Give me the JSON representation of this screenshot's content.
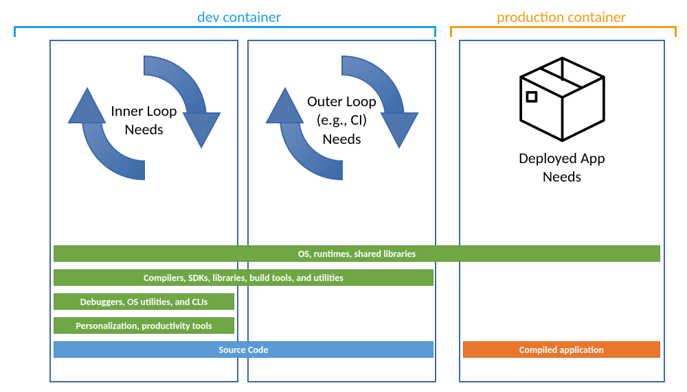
{
  "headers": {
    "dev": "dev container",
    "prod": "production container"
  },
  "columns": {
    "inner": {
      "label": "Inner Loop\nNeeds"
    },
    "outer": {
      "label": "Outer Loop\n(e.g., CI)\nNeeds"
    },
    "prod": {
      "label": "Deployed App\nNeeds"
    }
  },
  "layers": {
    "os": "OS, runtimes, shared libraries",
    "compilers": "Compilers, SDKs, libraries, build tools, and utilities",
    "debug": "Debuggers, OS utilities, and CLIs",
    "person": "Personalization, productivity tools",
    "source": "Source Code",
    "compiled": "Compiled application"
  },
  "colors": {
    "devAccent": "#1ba1e2",
    "prodAccent": "#f39c12",
    "boxBorder": "#3a6aa8",
    "greenBar": "#6ea744",
    "blueBar": "#5b9bd5",
    "orangeBar": "#e8762d",
    "arrowFill": "#5a7fb3",
    "arrowStroke": "#3a6aa8"
  }
}
